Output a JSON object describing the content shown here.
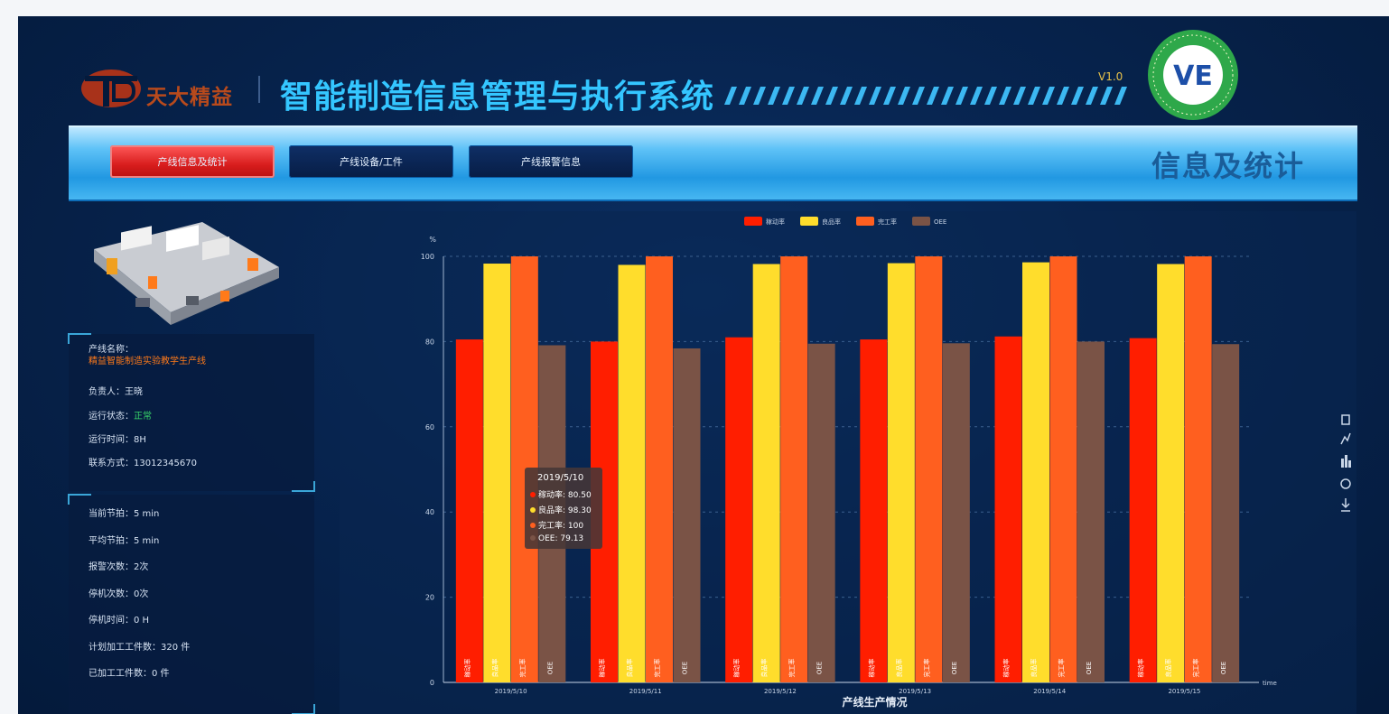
{
  "header": {
    "company": "天大精益",
    "app_title": "智能制造信息管理与执行系统",
    "version": "V1.0",
    "badge_text": "VE",
    "badge_ring_color": "#2ea84a"
  },
  "tabs": [
    {
      "label": "产线信息及统计",
      "active": true
    },
    {
      "label": "产线设备/工件",
      "active": false
    },
    {
      "label": "产线报警信息",
      "active": false
    }
  ],
  "section_title": "信息及统计",
  "info": {
    "line_name_label": "产线名称：",
    "line_name_value": "精益智能制造实验教学生产线",
    "owner_label": "负责人：",
    "owner_value": "王晓",
    "status_label": "运行状态：",
    "status_value": "正常",
    "runtime_label": "运行时间：",
    "runtime_value": "8H",
    "contact_label": "联系方式：",
    "contact_value": "13012345670"
  },
  "stats": {
    "items": [
      {
        "label": "当前节拍：",
        "value": "5 min"
      },
      {
        "label": "平均节拍：",
        "value": "5 min"
      },
      {
        "label": "报警次数：",
        "value": "2次"
      },
      {
        "label": "停机次数：",
        "value": "0次"
      },
      {
        "label": "停机时间：",
        "value": "0 H"
      },
      {
        "label": "计划加工工件数：",
        "value": "320 件"
      },
      {
        "label": "已加工工件数：",
        "value": "0 件"
      }
    ]
  },
  "chart_data": {
    "type": "bar",
    "title": "产线生产情况",
    "ylabel": "%",
    "xlabel": "",
    "x_axis_unit": "time",
    "ylim": [
      0,
      100
    ],
    "yticks": [
      0,
      20,
      40,
      60,
      80,
      100
    ],
    "grid": true,
    "legend_position": "top-center",
    "categories": [
      "2019/5/10",
      "2019/5/11",
      "2019/5/12",
      "2019/5/13",
      "2019/5/14",
      "2019/5/15"
    ],
    "series": [
      {
        "name": "稼动率",
        "color": "#ff1e00",
        "values": [
          80.5,
          80.0,
          81.0,
          80.5,
          81.2,
          80.8
        ]
      },
      {
        "name": "良品率",
        "color": "#ffdd2c",
        "values": [
          98.3,
          98.0,
          98.2,
          98.4,
          98.6,
          98.2
        ]
      },
      {
        "name": "完工率",
        "color": "#ff5f1f",
        "values": [
          100,
          100,
          100,
          100,
          100,
          100
        ]
      },
      {
        "name": "OEE",
        "color": "#7a5346",
        "values": [
          79.13,
          78.4,
          79.5,
          79.6,
          80.0,
          79.4
        ]
      }
    ],
    "bar_label_suffix": [
      ".",
      ".",
      ".",
      "."
    ],
    "tooltip": {
      "title": "2019/5/10",
      "rows": [
        {
          "name": "稼动率",
          "value": "80.50",
          "color": "#ff1e00"
        },
        {
          "name": "良品率",
          "value": "98.30",
          "color": "#ffdd2c"
        },
        {
          "name": "完工率",
          "value": "100",
          "color": "#ff5f1f"
        },
        {
          "name": "OEE",
          "value": "79.13",
          "color": "#7a5346"
        }
      ]
    }
  },
  "toolbox_icons": [
    "data-view-icon",
    "line-switch-icon",
    "bar-switch-icon",
    "restore-icon",
    "download-icon"
  ]
}
